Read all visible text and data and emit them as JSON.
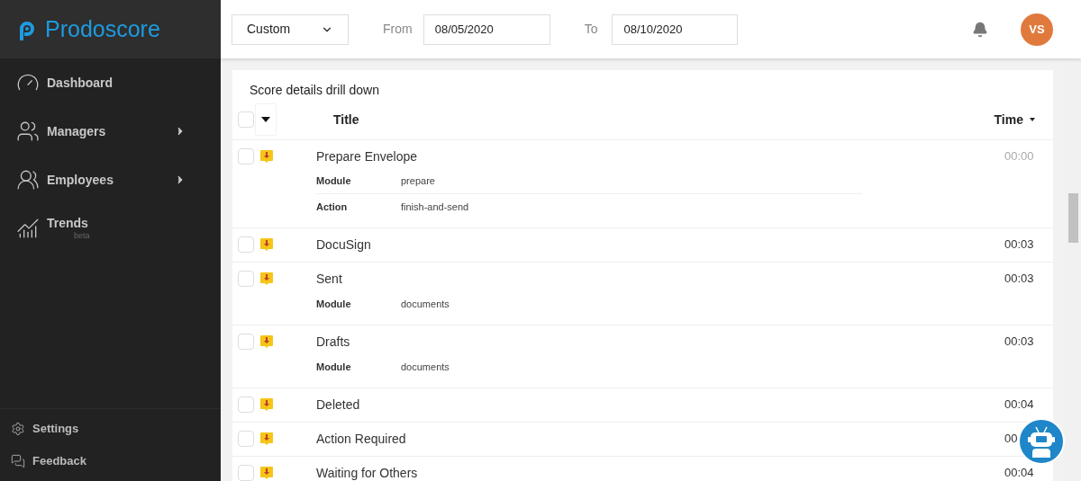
{
  "sidebar": {
    "logo": "Prodoscore",
    "items": [
      {
        "label": "Dashboard",
        "submenu": false
      },
      {
        "label": "Managers",
        "submenu": true
      },
      {
        "label": "Employees",
        "submenu": true
      },
      {
        "label": "Trends",
        "submenu": false,
        "badge": "beta"
      }
    ],
    "footer": [
      {
        "label": "Settings"
      },
      {
        "label": "Feedback"
      }
    ]
  },
  "header": {
    "range": "Custom",
    "from_label": "From",
    "from": "08/05/2020",
    "to_label": "To",
    "to": "08/10/2020",
    "avatar": "VS"
  },
  "card": {
    "title": "Score details drill down",
    "select_all_checked": false,
    "columns": [
      "Title",
      "Time"
    ],
    "rows": [
      {
        "title": "Prepare Envelope",
        "time": "00:00",
        "muted": true,
        "checked": false,
        "details": [
          {
            "label": "Module",
            "value": "prepare"
          },
          {
            "label": "Action",
            "value": "finish-and-send"
          }
        ]
      },
      {
        "title": "DocuSign",
        "time": "00:03",
        "muted": false,
        "checked": false
      },
      {
        "title": "Sent",
        "time": "00:03",
        "muted": false,
        "checked": false,
        "details": [
          {
            "label": "Module",
            "value": "documents"
          }
        ]
      },
      {
        "title": "Drafts",
        "time": "00:03",
        "muted": false,
        "checked": false,
        "details": [
          {
            "label": "Module",
            "value": "documents"
          }
        ]
      },
      {
        "title": "Deleted",
        "time": "00:04",
        "muted": false,
        "checked": false
      },
      {
        "title": "Action Required",
        "time": "00",
        "muted": false,
        "checked": false
      },
      {
        "title": "Waiting for Others",
        "time": "00:04",
        "muted": false,
        "checked": false
      }
    ]
  }
}
